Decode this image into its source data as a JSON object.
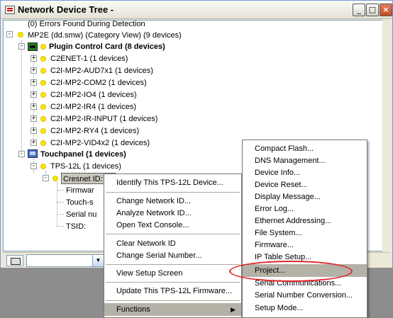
{
  "window": {
    "title": "Network Device Tree -",
    "min_btn": "_",
    "max_btn": "□",
    "close_btn": "×"
  },
  "tree": {
    "errors": "(0) Errors Found During Detection",
    "root": "MP2E (dd.smw) (Category View) (9 devices)",
    "plugin_group": "Plugin Control Card (8 devices)",
    "plugin_items": [
      "C2ENET-1 (1 devices)",
      "C2I-MP2-AUD7x1 (1 devices)",
      "C2I-MP2-COM2 (1 devices)",
      "C2I-MP2-IO4 (1 devices)",
      "C2I-MP2-IR4 (1 devices)",
      "C2I-MP2-IR-INPUT (1 devices)",
      "C2I-MP2-RY4 (1 devices)",
      "C2I-MP2-VID4x2 (1 devices)"
    ],
    "touch_group": "Touchpanel (1 devices)",
    "tps": "TPS-12L (1 devices)",
    "cresnet": "Cresnet ID: 03",
    "details": [
      "Firmwar",
      "Touch-s",
      "Serial nu",
      "TSID:"
    ]
  },
  "context_menu": {
    "items": [
      "Identify This TPS-12L Device...",
      "Change Network ID...",
      "Analyze Network ID...",
      "Open Text Console...",
      "Clear Network ID",
      "Change Serial Number...",
      "View Setup Screen",
      "Update This TPS-12L Firmware...",
      "Functions"
    ],
    "submenu_arrow": "▶"
  },
  "functions_submenu": {
    "items": [
      "Compact Flash...",
      "DNS Management...",
      "Device Info...",
      "Device Reset...",
      "Display Message...",
      "Error Log...",
      "Ethernet Addressing...",
      "File System...",
      "Firmware...",
      "IP Table Setup...",
      "Project...",
      "Serial Communications...",
      "Serial Number Conversion...",
      "Setup Mode..."
    ],
    "highlighted": "Project..."
  },
  "bottombar": {
    "combo_arrow": "▼"
  }
}
